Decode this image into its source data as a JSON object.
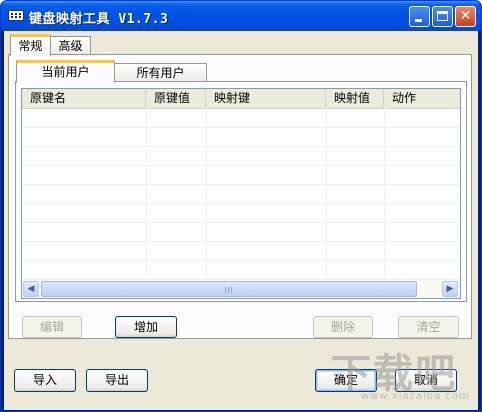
{
  "window": {
    "title": "键盘映射工具 V1.7.3"
  },
  "icons": {
    "app": "keyboard-icon",
    "minimize": "minimize-icon",
    "maximize": "maximize-icon",
    "close": "close-icon"
  },
  "tabs_main": [
    {
      "label": "常规",
      "selected": true
    },
    {
      "label": "高级",
      "selected": false
    }
  ],
  "tabs_user": [
    {
      "label": "当前用户",
      "selected": true
    },
    {
      "label": "所有用户",
      "selected": false
    }
  ],
  "table": {
    "columns": [
      "原键名",
      "原键值",
      "映射键",
      "映射值",
      "动作"
    ],
    "rows": []
  },
  "actions": {
    "edit": "编辑",
    "add": "增加",
    "delete": "删除",
    "clear": "清空"
  },
  "footer": {
    "import": "导入",
    "export": "导出",
    "ok": "确定",
    "cancel": "取消"
  },
  "watermark": {
    "logo": "下载吧",
    "url": "www.xiazaiba.com"
  }
}
